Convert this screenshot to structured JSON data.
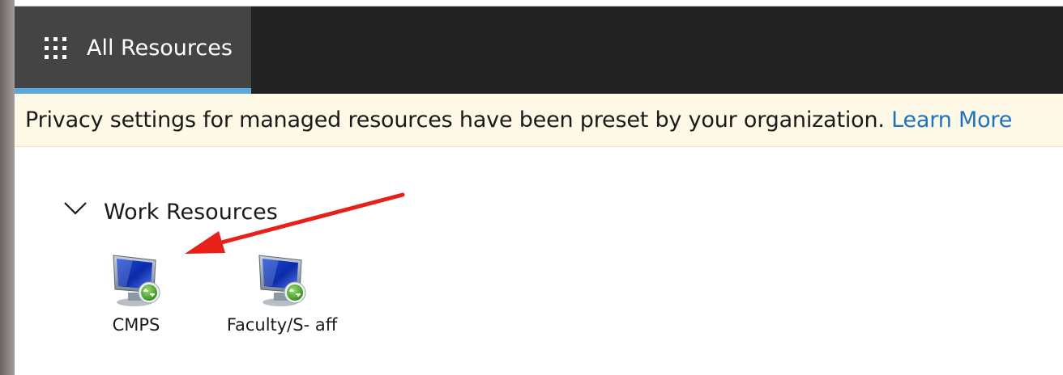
{
  "header": {
    "tab_label": "All Resources",
    "tab_icon": "waffle-grid-icon",
    "accent_color": "#5aa9dd"
  },
  "banner": {
    "message": "Privacy settings for managed resources have been preset by your organization.",
    "link_label": "Learn More",
    "link_color": "#1e73be"
  },
  "group": {
    "title": "Work Resources",
    "expanded": true,
    "items": [
      {
        "label": "CMPS",
        "icon": "remote-desktop-icon"
      },
      {
        "label": "Faculty/S- aff",
        "icon": "remote-desktop-icon"
      }
    ]
  },
  "annotation": {
    "type": "arrow",
    "color": "#e8201a",
    "target": "CMPS"
  }
}
